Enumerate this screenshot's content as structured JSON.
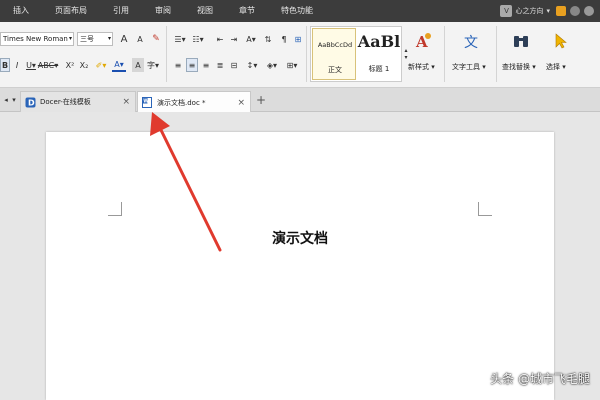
{
  "menubar": {
    "items": [
      "插入",
      "页面布局",
      "引用",
      "审阅",
      "视图",
      "章节",
      "特色功能"
    ],
    "user_name": "心之方向",
    "avatar_letter": "V"
  },
  "ribbon": {
    "font_name": "Times New Roman",
    "font_size": "三号",
    "styles": {
      "normal_preview": "AaBbCcDd",
      "normal_label": "正文",
      "heading_preview": "AaBl",
      "heading_label": "标题 1"
    },
    "new_style_label": "新样式",
    "text_tools_label": "文字工具",
    "find_replace_label": "查找替换",
    "select_label": "选择"
  },
  "tabs": [
    {
      "title": "Docer-在线模板",
      "close": "×"
    },
    {
      "title": "演示文档.doc *",
      "close": "×"
    }
  ],
  "add_tab": "+",
  "document": {
    "title": "演示文档"
  },
  "watermark": "头条 @城市飞毛腿",
  "colors": {
    "menubar_bg": "#3c3c3c",
    "arrow": "#e03a2e",
    "accent_blue": "#2a64b8"
  }
}
